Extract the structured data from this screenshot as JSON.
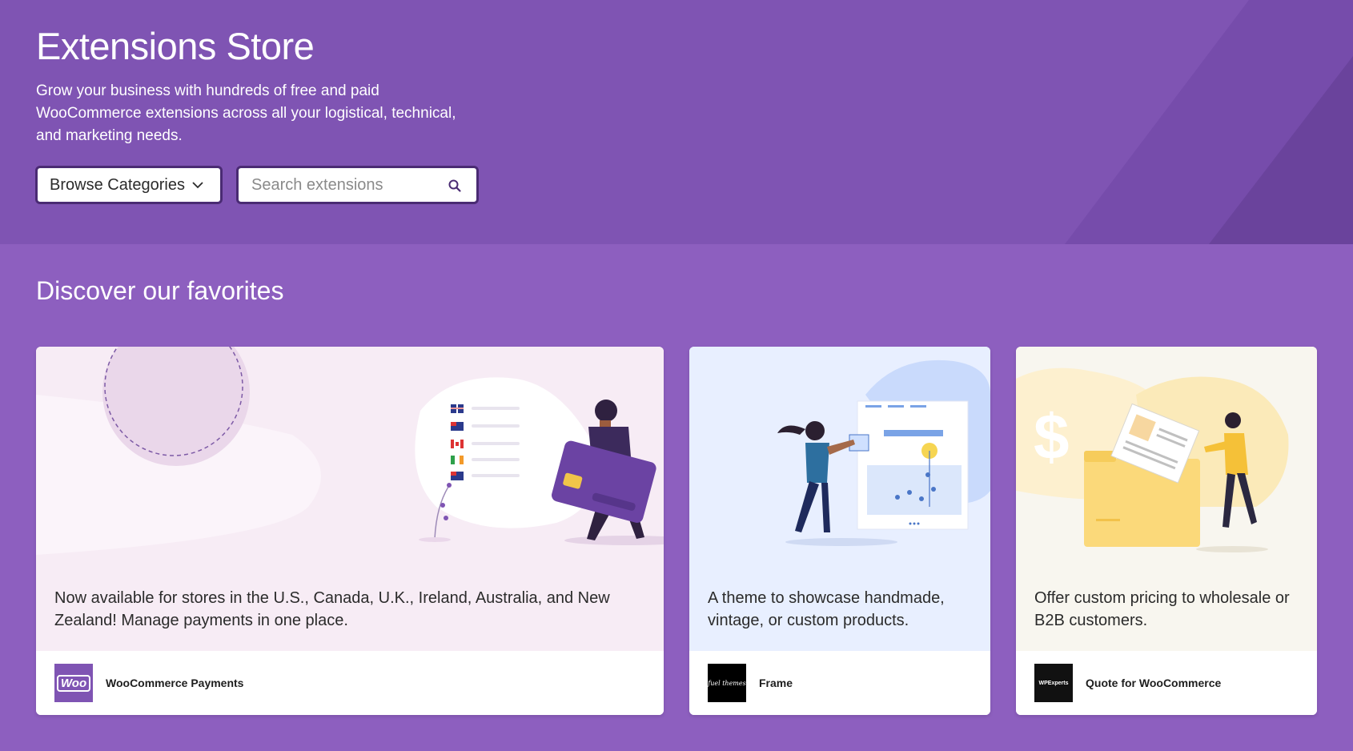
{
  "hero": {
    "title": "Extensions Store",
    "description": "Grow your business with hundreds of free and paid WooCommerce extensions across all your logistical, technical, and marketing needs.",
    "browse_label": "Browse Categories",
    "search_placeholder": "Search extensions"
  },
  "section": {
    "title": "Discover our favorites"
  },
  "cards": [
    {
      "text": "Now available for stores in the U.S., Canada, U.K., Ireland, Australia, and New Zealand! Manage payments in one place.",
      "product": "WooCommerce Payments",
      "logo_text": "Woo",
      "bg": "#f7ecf5"
    },
    {
      "text": "A theme to showcase handmade, vintage, or custom products.",
      "product": "Frame",
      "logo_text": "fuel themes",
      "bg": "#e8efff"
    },
    {
      "text": "Offer custom pricing to wholesale or B2B customers.",
      "product": "Quote for WooCommerce",
      "logo_text": "WPExperts",
      "bg": "#f8f6ef"
    }
  ],
  "colors": {
    "hero_bg": "#7f54b3",
    "section_bg": "#8d5fbf",
    "woo_purple": "#7f54b3"
  }
}
